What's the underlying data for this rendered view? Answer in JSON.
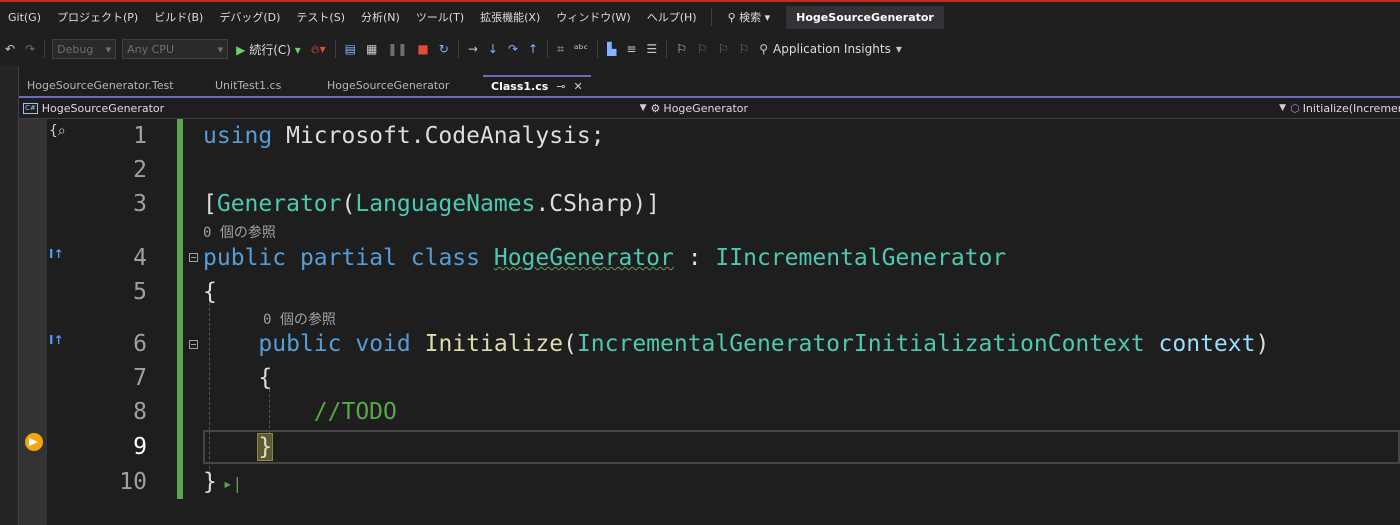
{
  "menu": {
    "items": [
      "Git(G)",
      "プロジェクト(P)",
      "ビルド(B)",
      "デバッグ(D)",
      "テスト(S)",
      "分析(N)",
      "ツール(T)",
      "拡張機能(X)",
      "ウィンドウ(W)",
      "ヘルプ(H)"
    ],
    "search": "検索",
    "solution": "HogeSourceGenerator"
  },
  "toolbar": {
    "config": "Debug",
    "platform": "Any CPU",
    "continue": "続行(C)",
    "app_insights": "Application Insights"
  },
  "tabs": [
    {
      "label": "HogeSourceGenerator.Test",
      "active": false
    },
    {
      "label": "UnitTest1.cs",
      "active": false
    },
    {
      "label": "HogeSourceGenerator",
      "active": false
    },
    {
      "label": "Class1.cs",
      "active": true
    }
  ],
  "navbar": {
    "project": "HogeSourceGenerator",
    "type": "HogeGenerator",
    "member": "Initialize(Incremen"
  },
  "code": {
    "line_numbers": [
      "1",
      "2",
      "3",
      "4",
      "5",
      "6",
      "7",
      "8",
      "9",
      "10"
    ],
    "refs_label": "0 個の参照",
    "l1_kw": "using",
    "l1_rest": " Microsoft.CodeAnalysis;",
    "l3_attr": "Generator",
    "l3_type": "LanguageNames",
    "l3_member": "CSharp",
    "l4_kw1": "public",
    "l4_kw2": "partial",
    "l4_kw3": "class",
    "l4_name": "HogeGenerator",
    "l4_iface": "IIncrementalGenerator",
    "l6_kw1": "public",
    "l6_kw2": "void",
    "l6_method": "Initialize",
    "l6_ptype": "IncrementalGeneratorInitializationContext",
    "l6_pname": "context",
    "l8_comment": "//TODO"
  },
  "colors": {
    "keyword": "#569cd6",
    "type": "#4ec9b0",
    "method": "#dcdcaa",
    "comment": "#57a64a",
    "param": "#9cdcfe",
    "accent": "#6c6cbf"
  }
}
